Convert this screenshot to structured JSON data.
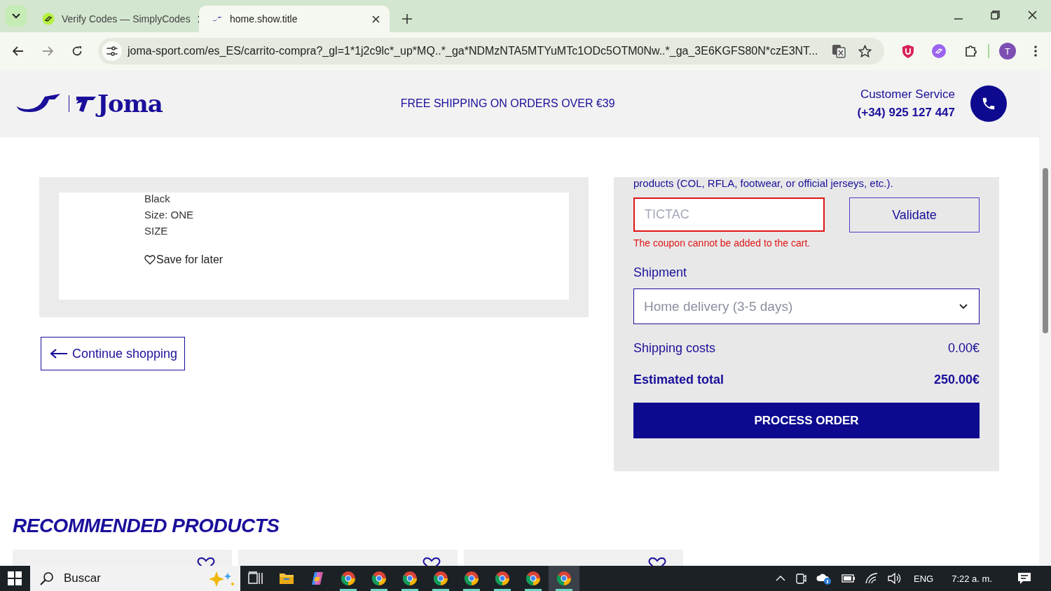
{
  "browser": {
    "tabs": [
      {
        "title": "Verify Codes — SimplyCodes",
        "selected": false,
        "kind": "simplycodes"
      },
      {
        "title": "home.show.title",
        "selected": true,
        "kind": "joma"
      }
    ],
    "url": "joma-sport.com/es_ES/carrito-compra?_gl=1*1j2c9lc*_up*MQ..*_ga*NDMzNTA5MTYuMTc1ODc5OTM0Nw..*_ga_3E6KGFS80N*czE3NT...",
    "profile_initial": "T"
  },
  "header": {
    "logo_text": "Joma",
    "shipping_banner": "FREE SHIPPING ON ORDERS OVER €39",
    "customer_service": "Customer Service",
    "phone": "(+34) 925 127 447"
  },
  "cart_item": {
    "details": [
      "Black",
      "Size: ONE",
      "SIZE"
    ],
    "save_for_later": "Save for later"
  },
  "continue_shopping": "Continue shopping",
  "summary": {
    "note": "products (COL, RFLA, footwear, or official jerseys, etc.).",
    "coupon": {
      "placeholder": "TICTAC",
      "invalid": true,
      "error": "The coupon cannot be added to the cart."
    },
    "validate": "Validate",
    "shipment_label": "Shipment",
    "shipment": "Home delivery (3-5 days)",
    "rows": [
      {
        "label": "Shipping costs",
        "value": "0.00€",
        "kind": "cost"
      },
      {
        "label": "Estimated total",
        "value": "250.00€",
        "kind": "total"
      }
    ],
    "process_order": "PROCESS ORDER"
  },
  "recommended": {
    "title": "RECOMMENDED PRODUCTS",
    "products": [
      {
        "favorite": false
      },
      {
        "favorite": false
      },
      {
        "favorite": false
      }
    ]
  },
  "taskbar": {
    "search_placeholder": "Buscar",
    "apps": [
      {
        "kind": "taskview",
        "open": false,
        "selected": false
      },
      {
        "kind": "explorer",
        "open": false,
        "selected": false
      },
      {
        "kind": "copilot",
        "open": false,
        "selected": false
      },
      {
        "kind": "chrome",
        "open": true,
        "selected": false
      },
      {
        "kind": "chrome",
        "open": true,
        "selected": false
      },
      {
        "kind": "chrome",
        "open": true,
        "selected": false
      },
      {
        "kind": "chrome",
        "open": true,
        "selected": false
      },
      {
        "kind": "chrome",
        "open": true,
        "selected": false
      },
      {
        "kind": "chrome",
        "open": true,
        "selected": false
      },
      {
        "kind": "chrome",
        "open": true,
        "selected": false
      },
      {
        "kind": "chrome",
        "open": true,
        "selected": true
      }
    ],
    "language": "ENG",
    "time": "7:22 a. m."
  }
}
